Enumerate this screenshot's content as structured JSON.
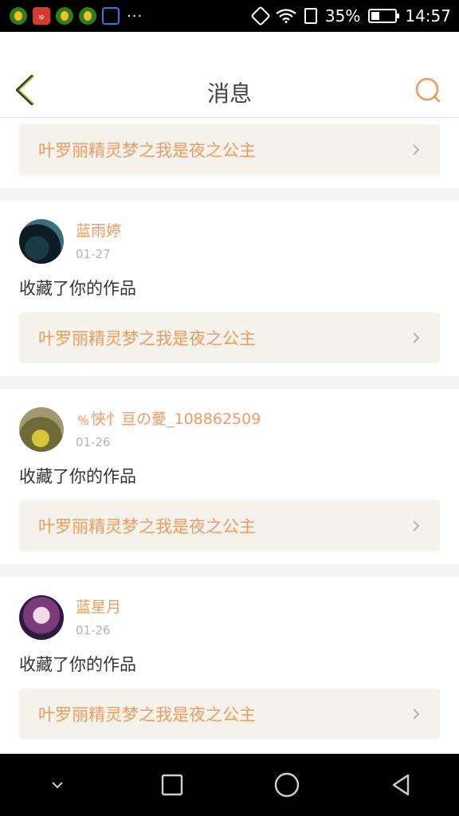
{
  "status_bar": {
    "app_icons": [
      "app-icon",
      "app-icon-red",
      "app-icon",
      "app-icon",
      "lock-app-icon"
    ],
    "app_red_label": "ゅ",
    "more": "···",
    "battery_percent": "35%",
    "battery_level": 0.35,
    "time": "14:57"
  },
  "header": {
    "title": "消息",
    "accent_color": "#f09a5d"
  },
  "first_card": {
    "work_title": "叶罗丽精灵梦之我是夜之公主"
  },
  "messages": [
    {
      "user": "蓝雨婷",
      "date": "01-27",
      "action": "收藏了你的作品",
      "work_title": "叶罗丽精灵梦之我是夜之公主"
    },
    {
      "user": "﹪悏忄亘の薆_108862509",
      "date": "01-26",
      "action": "收藏了你的作品",
      "work_title": "叶罗丽精灵梦之我是夜之公主"
    },
    {
      "user": "蓝星月",
      "date": "01-26",
      "action": "收藏了你的作品",
      "work_title": "叶罗丽精灵梦之我是夜之公主"
    }
  ]
}
